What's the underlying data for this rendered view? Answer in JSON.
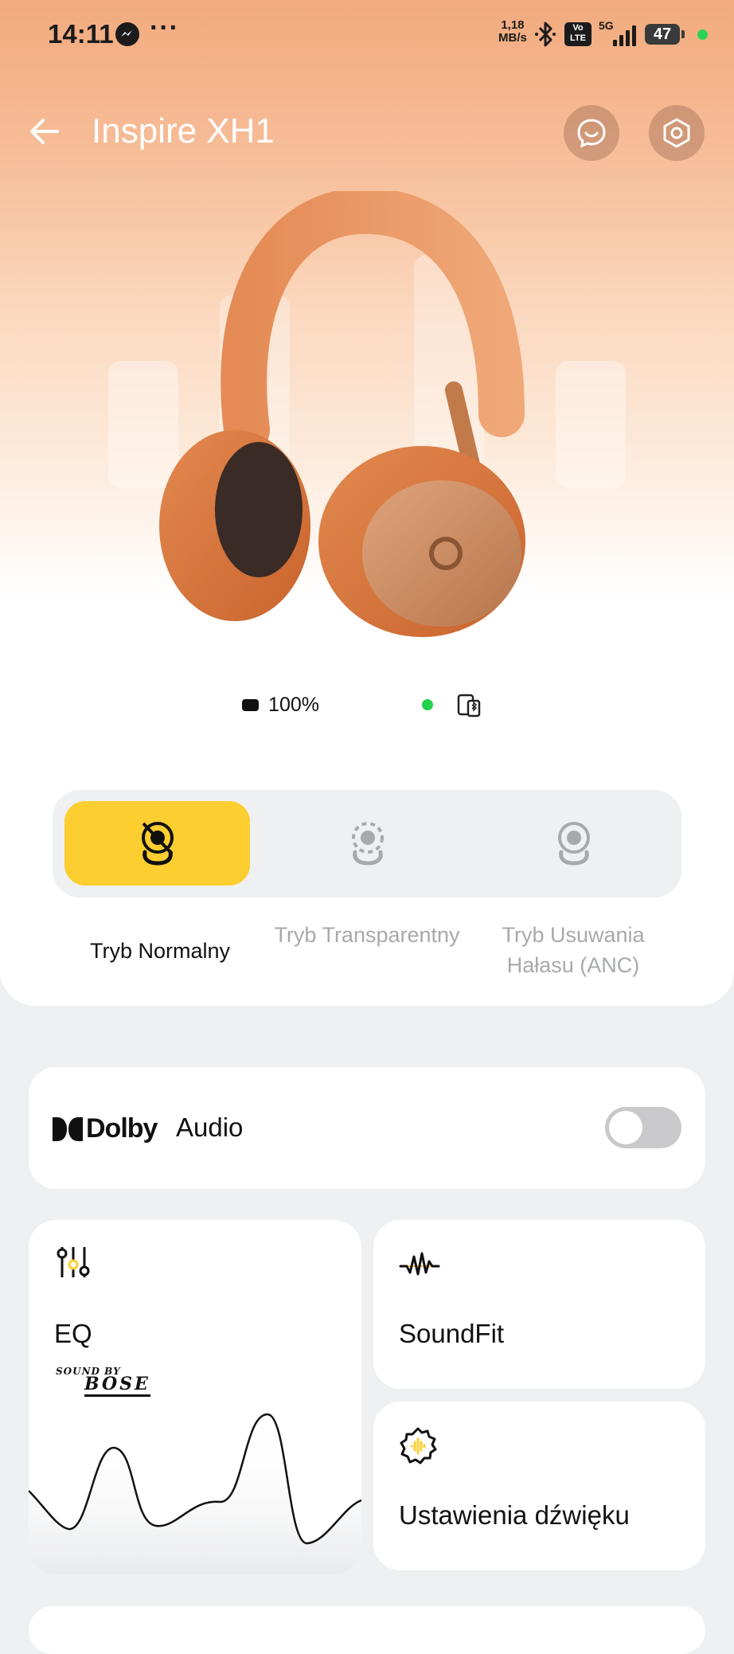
{
  "status_bar": {
    "time": "14:11",
    "more": "···",
    "speed_value": "1,18",
    "speed_unit": "MB/s",
    "volte_line1": "Vo",
    "volte_line2": "LTE",
    "network": "5G",
    "battery": "47"
  },
  "header": {
    "title": "Inspire XH1"
  },
  "device": {
    "battery_percent": "100%"
  },
  "modes": [
    {
      "label": "Tryb Normalny",
      "active": true
    },
    {
      "label": "Tryb Transparentny",
      "active": false
    },
    {
      "label": "Tryb Usuwania Hałasu (ANC)",
      "active": false
    }
  ],
  "dolby": {
    "brand": "Dolby",
    "label": "Audio",
    "enabled": false
  },
  "tiles": {
    "eq_label": "EQ",
    "bose_line1": "SOUND BY",
    "bose_line2": "BOSE",
    "soundfit_label": "SoundFit",
    "settings_label": "Ustawienia dźwięku"
  },
  "colors": {
    "accent_yellow": "#fcce2f",
    "header_peach": "#f2aa7e",
    "status_green": "#21d14b"
  }
}
